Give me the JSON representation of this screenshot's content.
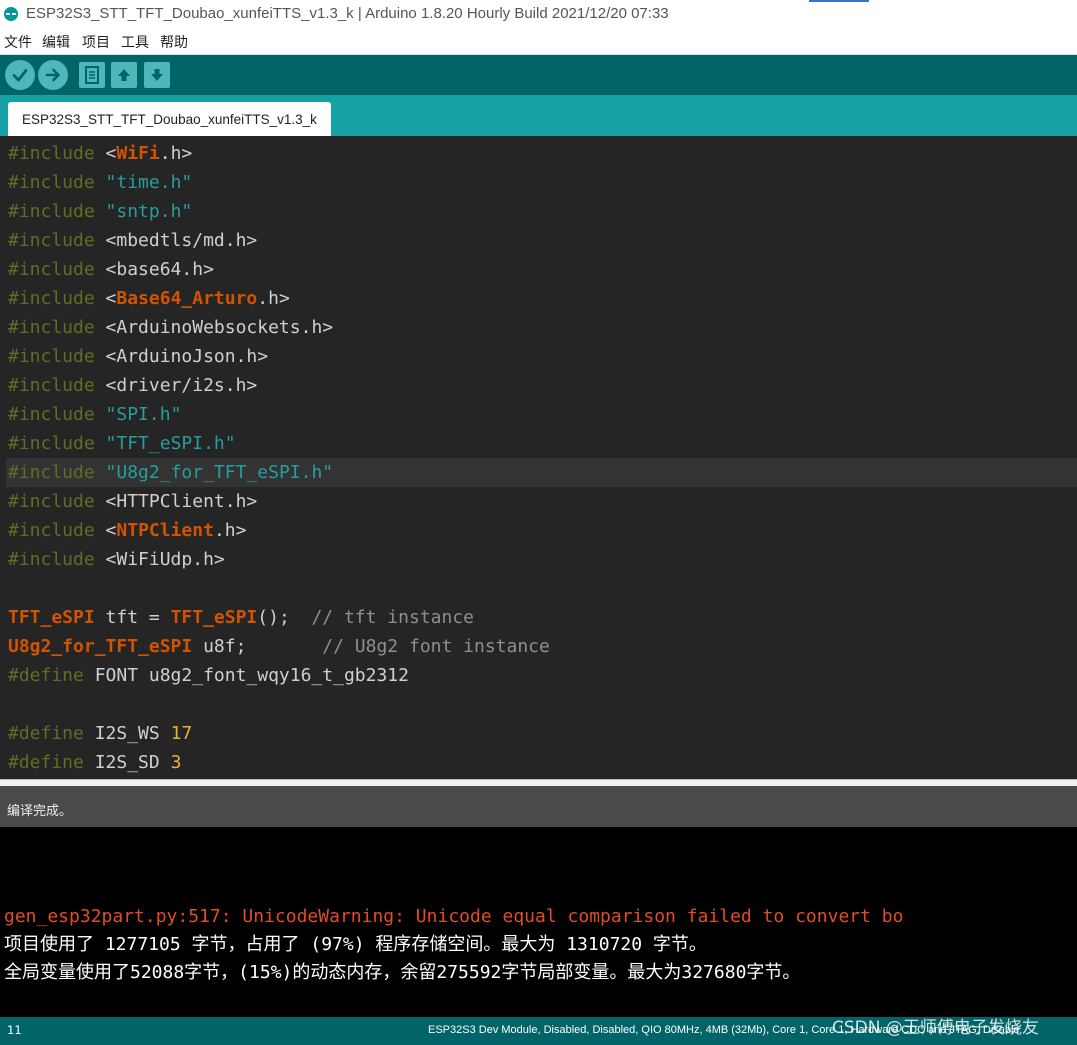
{
  "window": {
    "title": "ESP32S3_STT_TFT_Doubao_xunfeiTTS_v1.3_k | Arduino 1.8.20 Hourly Build 2021/12/20 07:33"
  },
  "menu": {
    "items": [
      "文件",
      "编辑",
      "项目",
      "工具",
      "帮助"
    ]
  },
  "toolbar": {
    "buttons": [
      {
        "name": "verify",
        "icon": "check-icon"
      },
      {
        "name": "upload",
        "icon": "arrow-right-icon"
      },
      {
        "name": "new",
        "icon": "document-icon"
      },
      {
        "name": "open",
        "icon": "arrow-up-icon"
      },
      {
        "name": "save",
        "icon": "arrow-down-icon"
      }
    ]
  },
  "tabs": [
    {
      "label": "ESP32S3_STT_TFT_Doubao_xunfeiTTS_v1.3_k",
      "active": true
    }
  ],
  "code": {
    "lines": [
      [
        {
          "t": "#include",
          "c": "dir"
        },
        {
          "t": " <",
          "c": "plain"
        },
        {
          "t": "WiFi",
          "c": "lib"
        },
        {
          "t": ".h>",
          "c": "plain"
        }
      ],
      [
        {
          "t": "#include",
          "c": "dir"
        },
        {
          "t": " ",
          "c": "plain"
        },
        {
          "t": "\"time.h\"",
          "c": "str"
        }
      ],
      [
        {
          "t": "#include",
          "c": "dir"
        },
        {
          "t": " ",
          "c": "plain"
        },
        {
          "t": "\"sntp.h\"",
          "c": "str"
        }
      ],
      [
        {
          "t": "#include",
          "c": "dir"
        },
        {
          "t": " <mbedtls/md.h>",
          "c": "plain"
        }
      ],
      [
        {
          "t": "#include",
          "c": "dir"
        },
        {
          "t": " <base64.h>",
          "c": "plain"
        }
      ],
      [
        {
          "t": "#include",
          "c": "dir"
        },
        {
          "t": " <",
          "c": "plain"
        },
        {
          "t": "Base64_Arturo",
          "c": "lib"
        },
        {
          "t": ".h>",
          "c": "plain"
        }
      ],
      [
        {
          "t": "#include",
          "c": "dir"
        },
        {
          "t": " <ArduinoWebsockets.h>",
          "c": "plain"
        }
      ],
      [
        {
          "t": "#include",
          "c": "dir"
        },
        {
          "t": " <ArduinoJson.h>",
          "c": "plain"
        }
      ],
      [
        {
          "t": "#include",
          "c": "dir"
        },
        {
          "t": " <driver/i2s.h>",
          "c": "plain"
        }
      ],
      [
        {
          "t": "#include",
          "c": "dir"
        },
        {
          "t": " ",
          "c": "plain"
        },
        {
          "t": "\"SPI.h\"",
          "c": "str"
        }
      ],
      [
        {
          "t": "#include",
          "c": "dir"
        },
        {
          "t": " ",
          "c": "plain"
        },
        {
          "t": "\"TFT_eSPI.h\"",
          "c": "str"
        }
      ],
      [
        {
          "t": "#include",
          "c": "dir"
        },
        {
          "t": " ",
          "c": "plain"
        },
        {
          "t": "\"U8g2_for_TFT_eSPI.h\"",
          "c": "str"
        }
      ],
      [
        {
          "t": "#include",
          "c": "dir"
        },
        {
          "t": " <HTTPClient.h>",
          "c": "plain"
        }
      ],
      [
        {
          "t": "#include",
          "c": "dir"
        },
        {
          "t": " <",
          "c": "plain"
        },
        {
          "t": "NTPClient",
          "c": "lib"
        },
        {
          "t": ".h>",
          "c": "plain"
        }
      ],
      [
        {
          "t": "#include",
          "c": "dir"
        },
        {
          "t": " <WiFiUdp.h>",
          "c": "plain"
        }
      ],
      [],
      [
        {
          "t": "TFT_eSPI",
          "c": "type"
        },
        {
          "t": " tft = ",
          "c": "plain"
        },
        {
          "t": "TFT_eSPI",
          "c": "type"
        },
        {
          "t": "();  ",
          "c": "plain"
        },
        {
          "t": "// tft instance",
          "c": "cmt"
        }
      ],
      [
        {
          "t": "U8g2_for_TFT_eSPI",
          "c": "type"
        },
        {
          "t": " u8f;       ",
          "c": "plain"
        },
        {
          "t": "// U8g2 font instance",
          "c": "cmt"
        }
      ],
      [
        {
          "t": "#define",
          "c": "dir"
        },
        {
          "t": " FONT u8g2_font_wqy16_t_gb2312",
          "c": "plain"
        }
      ],
      [],
      [
        {
          "t": "#define",
          "c": "dir"
        },
        {
          "t": " I2S_WS ",
          "c": "plain"
        },
        {
          "t": "17",
          "c": "num"
        }
      ],
      [
        {
          "t": "#define",
          "c": "dir"
        },
        {
          "t": " I2S_SD ",
          "c": "plain"
        },
        {
          "t": "3",
          "c": "num"
        }
      ]
    ],
    "highlighted_line": 11
  },
  "status": {
    "message": "编译完成。"
  },
  "console": {
    "lines": [
      {
        "text": "gen_esp32part.py:517: UnicodeWarning: Unicode equal comparison failed to convert bo",
        "kind": "warn"
      },
      {
        "text": "项目使用了 1277105 字节，占用了 (97%) 程序存储空间。最大为 1310720 字节。",
        "kind": "info"
      },
      {
        "text": "全局变量使用了52088字节，(15%)的动态内存，余留275592字节局部变量。最大为327680字节。",
        "kind": "info"
      }
    ]
  },
  "footer": {
    "line_number": "11",
    "board_info": "ESP32S3 Dev Module, Disabled, Disabled, QIO 80MHz, 4MB (32Mb), Core 1, Core 1, Hardware CDC and JTAG, Disable"
  },
  "watermark": "CSDN @王师傅电子发烧友",
  "colors": {
    "toolbar_bg": "#006468",
    "tab_strip_bg": "#17a1a5",
    "editor_bg": "#252525",
    "directive": "#5e6d03",
    "string": "#279da0",
    "library": "#d35400",
    "number": "#e8b23a",
    "comment": "#8f8f8f",
    "console_warning": "#e34c26"
  }
}
